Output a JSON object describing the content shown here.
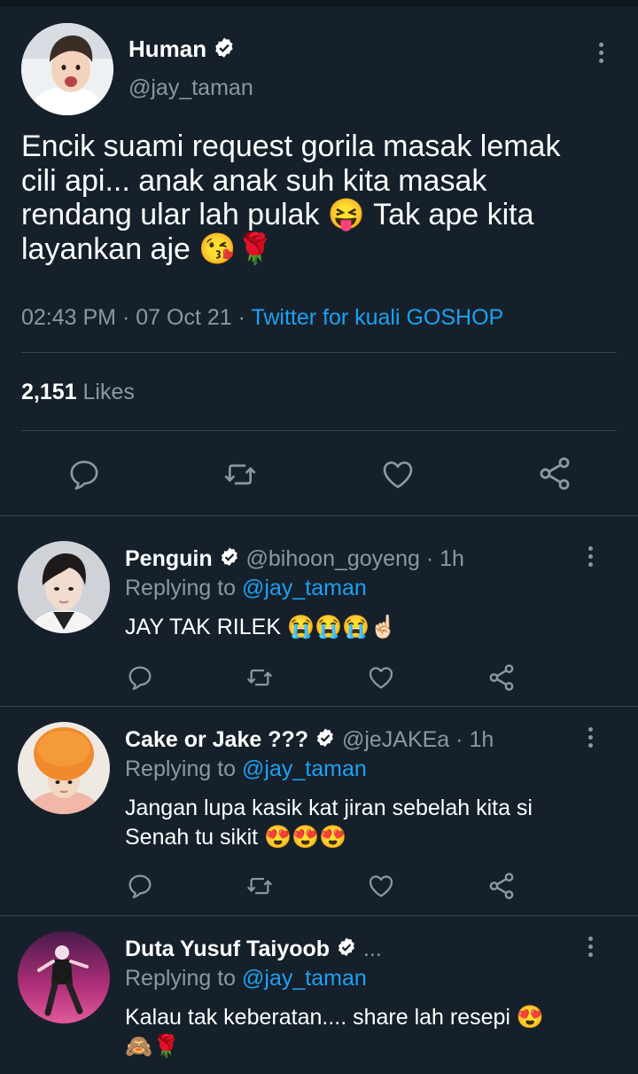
{
  "main_tweet": {
    "author_name": "Human",
    "handle": "@jay_taman",
    "text_lines": [
      "Encik suami request gorila masak lemak",
      "cili api... anak anak suh kita masak",
      "rendang ular lah pulak 😝 Tak ape kita",
      "layankan aje 😘🌹"
    ],
    "time": "02:43 PM",
    "date": "07 Oct 21",
    "source": "Twitter for kuali GOSHOP",
    "likes_count": "2,151",
    "likes_label": "Likes"
  },
  "replies": [
    {
      "name": "Penguin",
      "handle": "@bihoon_goyeng",
      "time": "1h",
      "replying_label": "Replying to",
      "replying_to": "@jay_taman",
      "text_lines": [
        "JAY TAK RILEK 😭😭😭☝🏻"
      ]
    },
    {
      "name": "Cake or Jake ???",
      "handle": "@jeJAKEa",
      "time": "1h",
      "replying_label": "Replying to",
      "replying_to": "@jay_taman",
      "text_lines": [
        "Jangan lupa kasik kat jiran sebelah kita si",
        "Senah tu sikit 😍😍😍"
      ]
    },
    {
      "name": "Duta Yusuf Taiyoob",
      "handle": "...",
      "replying_label": "Replying to",
      "replying_to": "@jay_taman",
      "text_lines": [
        "Kalau tak keberatan.... share lah resepi 😍",
        "🙈🌹"
      ]
    }
  ],
  "separator": "·",
  "colors": {
    "background": "#15202b",
    "divider": "#38444d",
    "muted": "#8899a6",
    "link": "#1da1f2",
    "text": "#ffffff"
  },
  "icons": {
    "reply": "reply-icon",
    "retweet": "retweet-icon",
    "like": "heart-icon",
    "share": "share-icon",
    "more": "more-icon",
    "verified": "verified-badge-icon"
  }
}
